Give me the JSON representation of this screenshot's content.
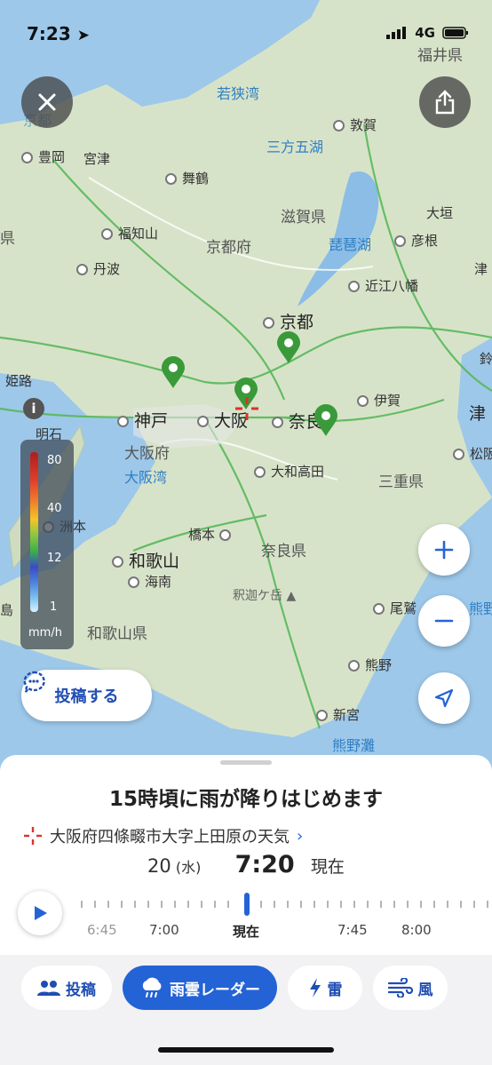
{
  "status_bar": {
    "time": "7:23",
    "network": "4G"
  },
  "map_labels": {
    "fukui": "福井県",
    "wakasa_bay": "若狭湾",
    "mikata": "三方五湖",
    "tsuruga": "敦賀",
    "toyooka": "豊岡",
    "miyazu": "宮津",
    "maizuru": "舞鶴",
    "fukuchiyama": "福知山",
    "tanba": "丹波",
    "kyoto_pref": "京都府",
    "shiga": "滋賀県",
    "biwako": "琵琶湖",
    "hikone": "彦根",
    "ogaki": "大垣",
    "omihachiman": "近江八幡",
    "kyoto": "京都",
    "himeji": "姫路",
    "akashi": "明石",
    "kobe": "神戸",
    "osaka": "大阪",
    "nara": "奈良",
    "iga": "伊賀",
    "tsu": "津",
    "matsusaka": "松阪",
    "osaka_pref": "大阪府",
    "osaka_bay": "大阪湾",
    "yamato_takada": "大和高田",
    "mie": "三重県",
    "sumoto": "洲本",
    "hashimoto": "橋本",
    "nara_pref": "奈良県",
    "wakayama": "和歌山",
    "kainan": "海南",
    "shakagatake": "釈迦ケ岳",
    "wakayama_pref": "和歌山県",
    "owase": "尾鷲",
    "kumano": "熊野",
    "shingu": "新宮",
    "kumanonada": "熊野灘",
    "edge_shima": "島",
    "edge_kumano": "熊野",
    "edge_mie1": "津",
    "edge_mie2": "鈴",
    "edge_ken": "県",
    "edge_kyo": "京都"
  },
  "legend": {
    "ticks": [
      "80",
      "40",
      "12",
      "1"
    ],
    "unit": "mm/h"
  },
  "post_button": {
    "label": "投稿する"
  },
  "sheet": {
    "headline": "15時頃に雨が降りはじめます",
    "location": "大阪府四條畷市大字上田原の天気",
    "date": "20",
    "weekday": "(水)",
    "time": "7:20",
    "now_label": "現在"
  },
  "timeline": {
    "labels": [
      "6:45",
      "7:00",
      "現在",
      "7:45",
      "8:00"
    ]
  },
  "tabs": [
    {
      "label": "投稿",
      "icon": "people-icon"
    },
    {
      "label": "雨雲レーダー",
      "icon": "rain-cloud-icon"
    },
    {
      "label": "雷",
      "icon": "lightning-icon"
    },
    {
      "label": "風",
      "icon": "wind-icon"
    }
  ],
  "colors": {
    "accent": "#2463d6",
    "land": "#d7e3c9",
    "water": "#8bbde6",
    "marker": "#3a9a3a"
  }
}
